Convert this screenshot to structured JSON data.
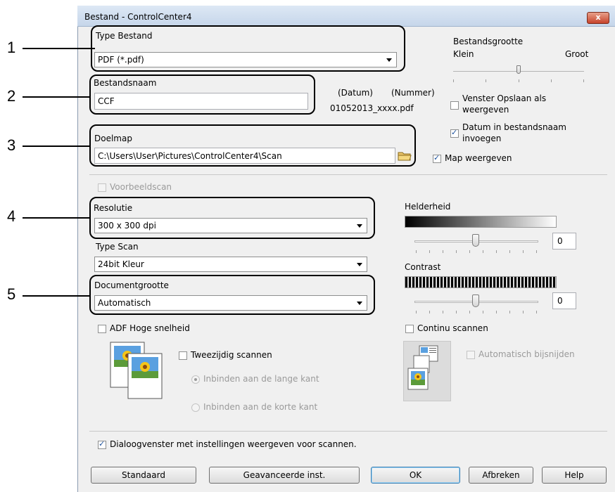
{
  "window": {
    "title": "Bestand - ControlCenter4",
    "close_symbol": "x"
  },
  "callouts": [
    "1",
    "2",
    "3",
    "4",
    "5"
  ],
  "file_type": {
    "label": "Type Bestand",
    "value": "PDF (*.pdf)"
  },
  "file_size": {
    "label": "Bestandsgrootte",
    "min_label": "Klein",
    "max_label": "Groot"
  },
  "file_name": {
    "label": "Bestandsnaam",
    "value": "CCF",
    "date_label": "(Datum)",
    "number_label": "(Nummer)",
    "example": "01052013_xxxx.pdf"
  },
  "show_save_as": {
    "label_line1": "Venster Opslaan als",
    "label_line2": "weergeven",
    "checked": false
  },
  "date_in_name": {
    "label_line1": "Datum in bestandsnaam",
    "label_line2": "invoegen",
    "checked": true
  },
  "destination": {
    "label": "Doelmap",
    "value": "C:\\Users\\User\\Pictures\\ControlCenter4\\Scan"
  },
  "show_folder": {
    "label": "Map weergeven",
    "checked": true
  },
  "preview_scan": {
    "label": "Voorbeeldscan",
    "checked": false,
    "disabled": true
  },
  "resolution": {
    "label": "Resolutie",
    "value": "300 x 300 dpi"
  },
  "scan_type": {
    "label": "Type Scan",
    "value": "24bit Kleur"
  },
  "document_size": {
    "label": "Documentgrootte",
    "value": "Automatisch"
  },
  "brightness": {
    "label": "Helderheid",
    "value": "0"
  },
  "contrast": {
    "label": "Contrast",
    "value": "0"
  },
  "adf_high_speed": {
    "label": "ADF Hoge snelheid",
    "checked": false
  },
  "continuous_scan": {
    "label": "Continu scannen",
    "checked": false
  },
  "duplex": {
    "label": "Tweezijdig scannen",
    "checked": false,
    "options": [
      "Inbinden aan de lange kant",
      "Inbinden aan de korte kant"
    ],
    "selected_index": 0
  },
  "auto_crop": {
    "label": "Automatisch bijsnijden",
    "checked": false,
    "disabled": true
  },
  "show_dialog": {
    "label": "Dialoogvenster met instellingen weergeven voor scannen.",
    "checked": true
  },
  "buttons": {
    "default": "Standaard",
    "advanced": "Geavanceerde inst.",
    "ok": "OK",
    "cancel": "Afbreken",
    "help": "Help"
  }
}
